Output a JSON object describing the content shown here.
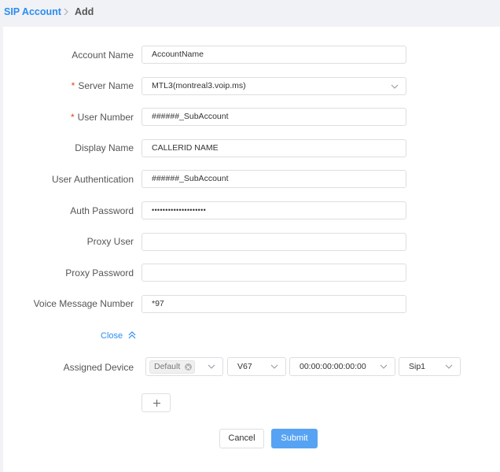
{
  "breadcrumb": {
    "root": "SIP Account",
    "current": "Add"
  },
  "form": {
    "account_name": {
      "label": "Account Name",
      "value": "AccountName",
      "required": false
    },
    "server_name": {
      "label": "Server Name",
      "value": "MTL3(montreal3.voip.ms)",
      "required": true
    },
    "user_number": {
      "label": "User Number",
      "value": "######_SubAccount",
      "required": true
    },
    "display_name": {
      "label": "Display Name",
      "value": "CALLERID NAME",
      "required": false
    },
    "user_authentication": {
      "label": "User Authentication",
      "value": "######_SubAccount",
      "required": false
    },
    "auth_password": {
      "label": "Auth Password",
      "value": "••••••••••••••••••••",
      "required": false
    },
    "proxy_user": {
      "label": "Proxy User",
      "value": "",
      "required": false
    },
    "proxy_password": {
      "label": "Proxy Password",
      "value": "",
      "required": false
    },
    "voice_message_number": {
      "label": "Voice Message Number",
      "value": "*97",
      "required": false
    }
  },
  "close_link": {
    "label": "Close",
    "icon": "double-chevron-up-icon"
  },
  "assigned_device": {
    "label": "Assigned Device",
    "device_tag": "Default",
    "model": "V67",
    "mac": "00:00:00:00:00:00",
    "line": "Sip1"
  },
  "add_button": {
    "icon": "plus-icon"
  },
  "actions": {
    "cancel": "Cancel",
    "submit": "Submit"
  },
  "colors": {
    "accent": "#2d8cf0",
    "submit_bg": "#57a3f3",
    "required": "#ed4014",
    "page_bg": "#f0f2f5",
    "border": "#dcdee2"
  }
}
